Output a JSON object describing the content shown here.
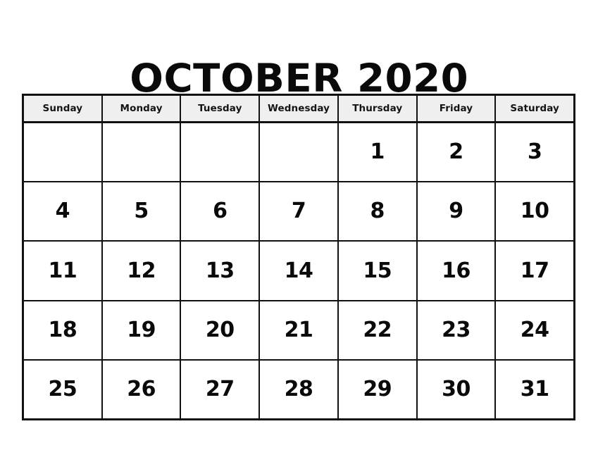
{
  "document": {
    "type": "printable-monthly-calendar",
    "title": "OCTOBER 2020",
    "month": "OCTOBER",
    "year": "2020"
  },
  "colors": {
    "page_background": "#ffffff",
    "grid_line": "#111111",
    "header_background": "#efefef",
    "text": "#0a0a0a"
  },
  "calendar": {
    "weekday_headers": [
      {
        "label": "Sunday"
      },
      {
        "label": "Monday"
      },
      {
        "label": "Tuesday"
      },
      {
        "label": "Wednesday"
      },
      {
        "label": "Thursday"
      },
      {
        "label": "Friday"
      },
      {
        "label": "Saturday"
      }
    ],
    "weeks": [
      {
        "days": [
          {
            "label": ""
          },
          {
            "label": ""
          },
          {
            "label": ""
          },
          {
            "label": ""
          },
          {
            "label": "1"
          },
          {
            "label": "2"
          },
          {
            "label": "3"
          }
        ]
      },
      {
        "days": [
          {
            "label": "4"
          },
          {
            "label": "5"
          },
          {
            "label": "6"
          },
          {
            "label": "7"
          },
          {
            "label": "8"
          },
          {
            "label": "9"
          },
          {
            "label": "10"
          }
        ]
      },
      {
        "days": [
          {
            "label": "11"
          },
          {
            "label": "12"
          },
          {
            "label": "13"
          },
          {
            "label": "14"
          },
          {
            "label": "15"
          },
          {
            "label": "16"
          },
          {
            "label": "17"
          }
        ]
      },
      {
        "days": [
          {
            "label": "18"
          },
          {
            "label": "19"
          },
          {
            "label": "20"
          },
          {
            "label": "21"
          },
          {
            "label": "22"
          },
          {
            "label": "23"
          },
          {
            "label": "24"
          }
        ]
      },
      {
        "days": [
          {
            "label": "25"
          },
          {
            "label": "26"
          },
          {
            "label": "27"
          },
          {
            "label": "28"
          },
          {
            "label": "29"
          },
          {
            "label": "30"
          },
          {
            "label": "31"
          }
        ]
      }
    ]
  }
}
